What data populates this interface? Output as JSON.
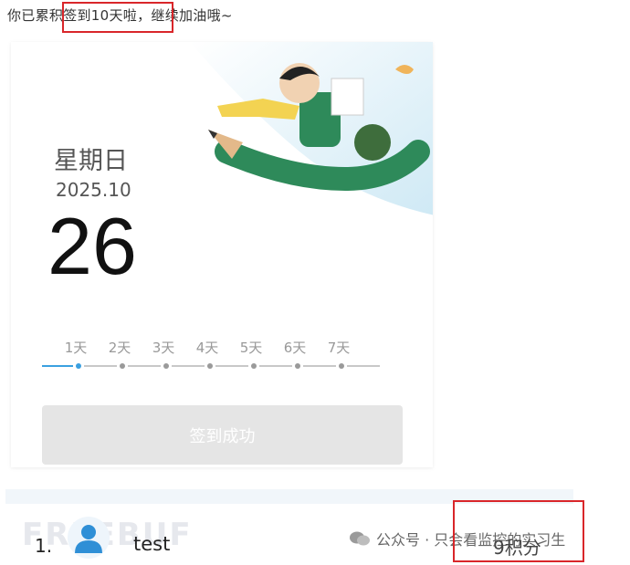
{
  "header": {
    "streak_message": "你已累积签到10天啦，继续加油哦~"
  },
  "calendar": {
    "weekday": "星期日",
    "year_month": "2025.10",
    "day": "26"
  },
  "progress": {
    "days": [
      "1天",
      "2天",
      "3天",
      "4天",
      "5天",
      "6天",
      "7天"
    ],
    "current_day_index": 0
  },
  "signin": {
    "button_label": "签到成功"
  },
  "ranking": {
    "rank": "1.",
    "username": "test",
    "points": "9积分"
  },
  "watermark": {
    "background_text": "FREEBUF",
    "account_label": "公众号 · 只会看监控的实习生"
  },
  "colors": {
    "highlight_border": "#d9262a",
    "progress_active": "#3aa0e0",
    "button_bg": "#e5e5e5"
  }
}
